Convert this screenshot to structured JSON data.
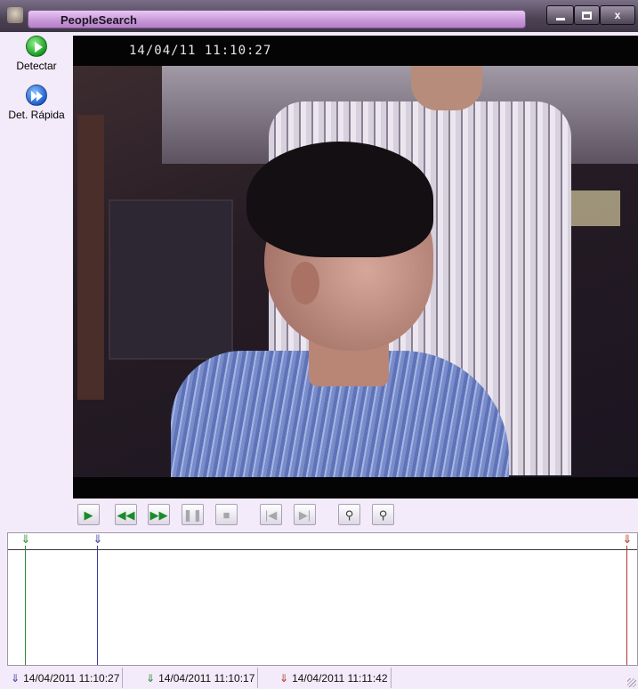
{
  "window": {
    "title": "PeopleSearch",
    "close_label": "x"
  },
  "toolbar": {
    "detect_label": "Detectar",
    "fast_detect_label": "Det. Rápida"
  },
  "video": {
    "timestamp": "14/04/11 11:10:27"
  },
  "playback": {
    "buttons": [
      {
        "name": "play",
        "icon": "play-icon",
        "enabled": true
      },
      {
        "name": "rewind",
        "icon": "rewind-icon",
        "enabled": true
      },
      {
        "name": "fast-forward",
        "icon": "fast-forward-icon",
        "enabled": true
      },
      {
        "name": "pause",
        "icon": "pause-icon",
        "enabled": false
      },
      {
        "name": "stop",
        "icon": "stop-icon",
        "enabled": false
      },
      {
        "name": "previous",
        "icon": "skip-back-icon",
        "enabled": false
      },
      {
        "name": "next",
        "icon": "skip-forward-icon",
        "enabled": false
      },
      {
        "name": "zoom",
        "icon": "magnifier-icon",
        "enabled": true
      },
      {
        "name": "zoom-fit",
        "icon": "zoom-fit-icon",
        "enabled": true
      }
    ]
  },
  "timeline": {
    "markers": [
      {
        "color": "#2c8a35",
        "label": "start"
      },
      {
        "color": "#3d3aa0",
        "label": "current"
      },
      {
        "color": "#b2342c",
        "label": "end"
      }
    ]
  },
  "status": {
    "current_time": "14/04/2011 11:10:27",
    "start_time": "14/04/2011 11:10:17",
    "end_time": "14/04/2011 11:11:42"
  },
  "colors": {
    "accent": "#c99ad9",
    "background": "#f3ebf9",
    "marker_start": "#2c8a35",
    "marker_current": "#3d3aa0",
    "marker_end": "#b2342c"
  }
}
